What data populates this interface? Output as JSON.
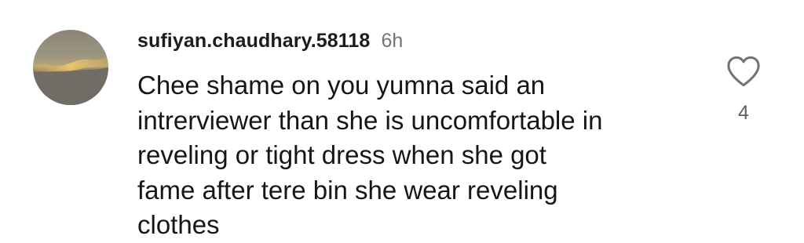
{
  "comment": {
    "username": "sufiyan.chaudhary.58118",
    "time": "6h",
    "text": "Chee shame on you yumna said an\nintrerviewer than she is uncomfortable in\nreveling or tight dress when she got\nfame after tere bin she wear reveling\nclothes",
    "like_count": "4",
    "avatar_icon": "sunset-sky-avatar",
    "like_icon": "heart-outline-icon"
  }
}
